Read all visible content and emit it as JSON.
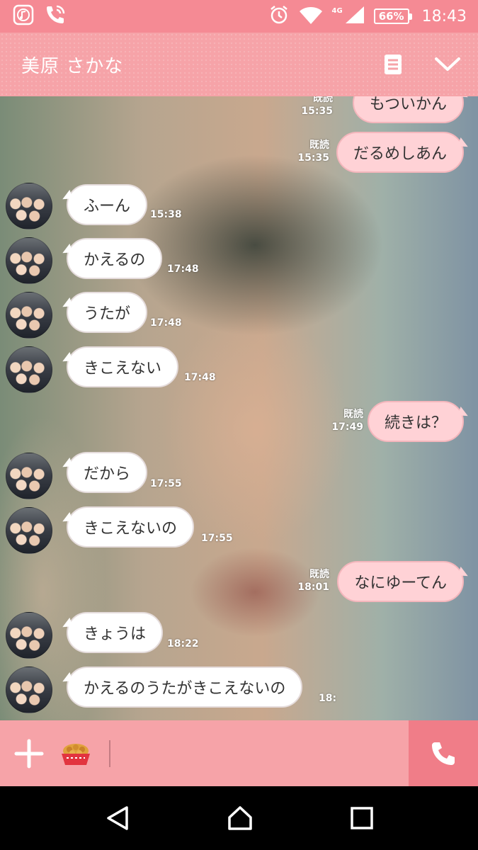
{
  "status_bar": {
    "time": "18:43",
    "battery": "66%",
    "network": "4G",
    "icons": [
      "music-app-icon",
      "wifi-call-icon",
      "alarm-icon",
      "wifi-icon",
      "signal-icon",
      "battery-icon"
    ]
  },
  "header": {
    "contact_name": "美原 さかな",
    "icons": [
      "notes-icon",
      "chevron-down-icon"
    ]
  },
  "colors": {
    "status_bar": "#f58a94",
    "header": "#f6a3a8",
    "incoming_bubble": "#ffffff",
    "outgoing_bubble": "#ffd2d6",
    "call_button": "#f07d88"
  },
  "messages": [
    {
      "side": "out",
      "text": "もついかん",
      "read": "既読",
      "time": "15:35"
    },
    {
      "side": "out",
      "text": "だるめしあん",
      "read": "既読",
      "time": "15:35"
    },
    {
      "side": "in",
      "text": "ふーん",
      "time": "15:38"
    },
    {
      "side": "in",
      "text": "かえるの",
      "time": "17:48"
    },
    {
      "side": "in",
      "text": "うたが",
      "time": "17:48"
    },
    {
      "side": "in",
      "text": "きこえない",
      "time": "17:48"
    },
    {
      "side": "out",
      "text": "続きは？",
      "read": "既読",
      "time": "17:49"
    },
    {
      "side": "in",
      "text": "だから",
      "time": "17:55"
    },
    {
      "side": "in",
      "text": "きこえないの",
      "time": "17:55"
    },
    {
      "side": "out",
      "text": "なにゆーてん",
      "read": "既読",
      "time": "18:01"
    },
    {
      "side": "in",
      "text": "きょうは",
      "time": "18:22"
    },
    {
      "side": "in",
      "text": "かえるのうたがきこえないの",
      "time": "18:"
    }
  ],
  "input_bar": {
    "icons": [
      "plus-icon",
      "sticker-food-icon",
      "phone-icon"
    ]
  },
  "nav_bar": {
    "icons": [
      "back-icon",
      "home-icon",
      "recents-icon"
    ]
  }
}
